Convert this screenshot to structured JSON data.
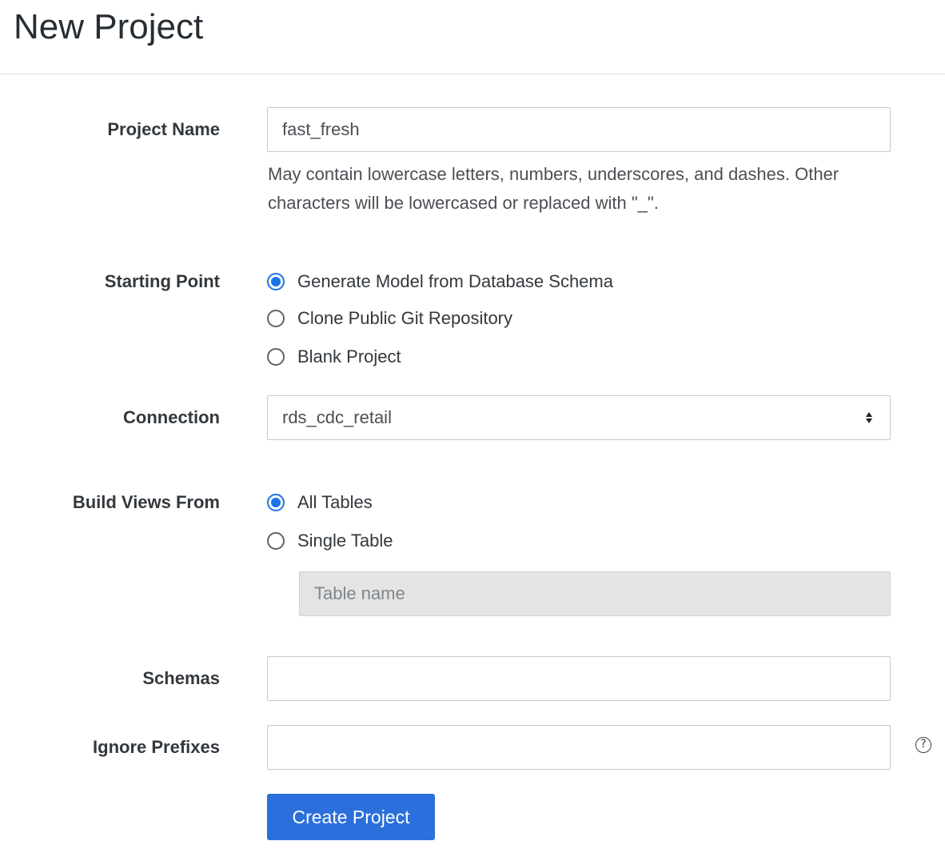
{
  "page": {
    "title": "New Project"
  },
  "form": {
    "project_name": {
      "label": "Project Name",
      "value": "fast_fresh",
      "help": "May contain lowercase letters, numbers, underscores, and dashes. Other characters will be lowercased or replaced with \"_\"."
    },
    "starting_point": {
      "label": "Starting Point",
      "options": [
        {
          "label": "Generate Model from Database Schema",
          "selected": true
        },
        {
          "label": "Clone Public Git Repository",
          "selected": false
        },
        {
          "label": "Blank Project",
          "selected": false
        }
      ]
    },
    "connection": {
      "label": "Connection",
      "value": "rds_cdc_retail"
    },
    "build_views_from": {
      "label": "Build Views From",
      "options": [
        {
          "label": "All Tables",
          "selected": true
        },
        {
          "label": "Single Table",
          "selected": false
        }
      ],
      "table_name_placeholder": "Table name"
    },
    "schemas": {
      "label": "Schemas",
      "value": ""
    },
    "ignore_prefixes": {
      "label": "Ignore Prefixes",
      "value": "",
      "help_icon": "?"
    },
    "submit_label": "Create Project"
  },
  "colors": {
    "accent": "#1a73e8",
    "button": "#2a6fdb"
  }
}
